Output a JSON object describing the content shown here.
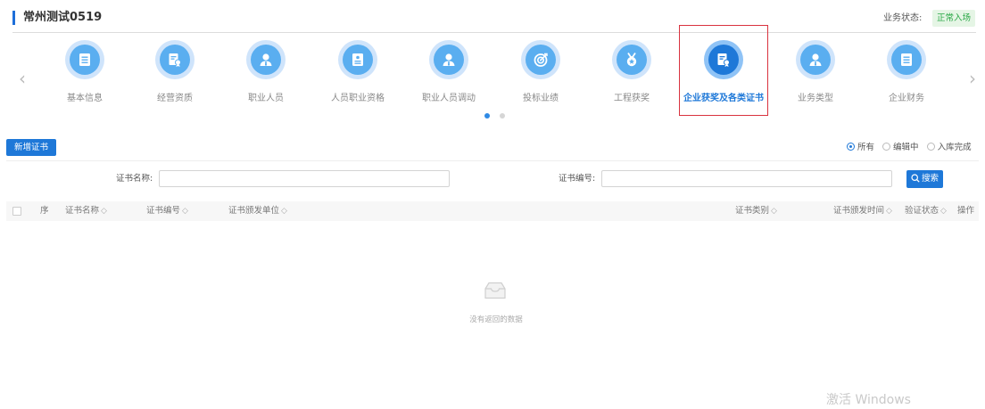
{
  "header": {
    "title": "常州测试0519",
    "status_label": "业务状态:",
    "status_value": "正常入场"
  },
  "colors": {
    "accent": "#1e78d8",
    "status_green": "#28a745",
    "highlight_red": "#d9333f"
  },
  "carousel": {
    "items": [
      {
        "label": "基本信息",
        "icon": "list-icon"
      },
      {
        "label": "经营资质",
        "icon": "certificate-icon"
      },
      {
        "label": "职业人员",
        "icon": "person-icon"
      },
      {
        "label": "人员职业资格",
        "icon": "badge-icon"
      },
      {
        "label": "职业人员调动",
        "icon": "person-icon"
      },
      {
        "label": "投标业绩",
        "icon": "target-icon"
      },
      {
        "label": "工程获奖",
        "icon": "medal-icon"
      },
      {
        "label": "企业获奖及各类证书",
        "icon": "certificate-icon",
        "active": true
      },
      {
        "label": "业务类型",
        "icon": "person-icon"
      },
      {
        "label": "企业财务",
        "icon": "list-icon"
      }
    ],
    "prev_arrow": "‹",
    "next_arrow": "›"
  },
  "toolbar": {
    "add_label": "新增证书",
    "filters": [
      {
        "label": "所有",
        "checked": true
      },
      {
        "label": "编辑中",
        "checked": false
      },
      {
        "label": "入库完成",
        "checked": false
      }
    ]
  },
  "search": {
    "name_label": "证书名称:",
    "name_value": "",
    "number_label": "证书编号:",
    "number_value": "",
    "button_label": "搜索"
  },
  "table": {
    "columns": [
      "序",
      "证书名称",
      "证书编号",
      "证书颁发单位",
      "证书类别",
      "证书颁发时间",
      "验证状态",
      "操作"
    ],
    "rows": [],
    "empty_text": "没有返回的数据"
  },
  "watermark": "激活 Windows"
}
